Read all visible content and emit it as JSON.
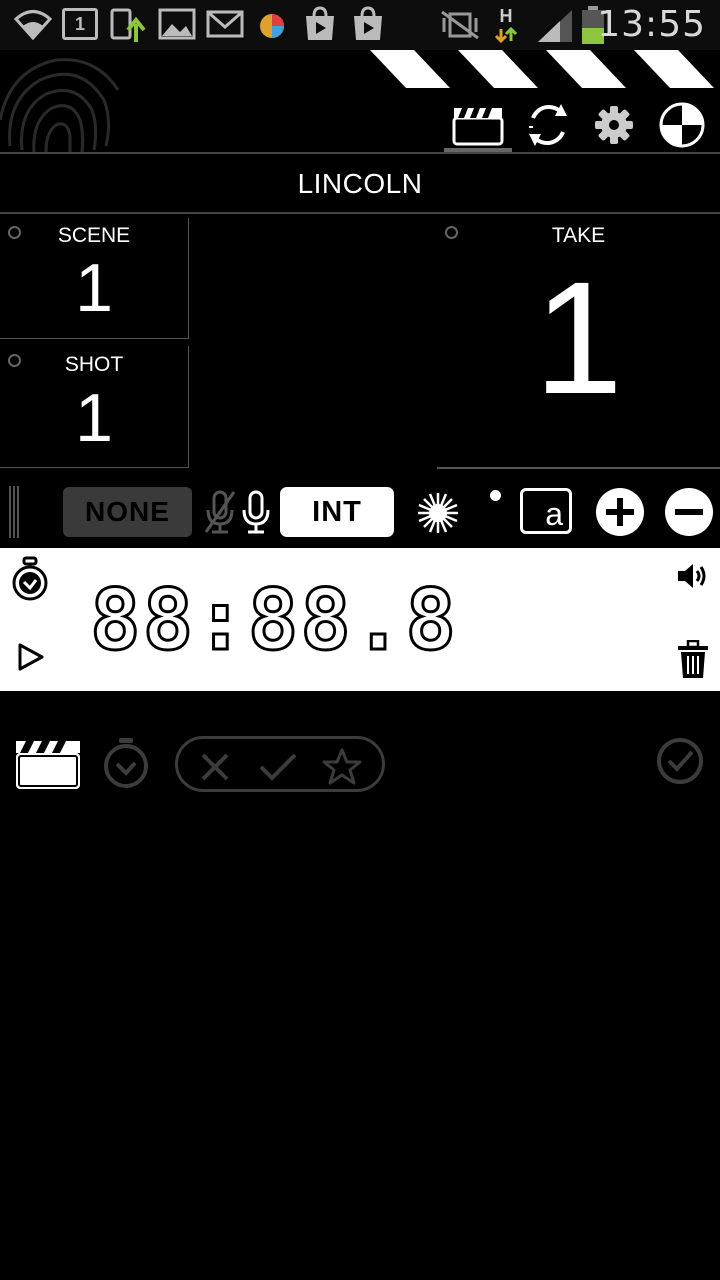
{
  "status_bar": {
    "time": "13:55",
    "network_type": "H",
    "notification_date": "1",
    "icons": [
      "wifi-icon",
      "calendar-icon",
      "upload-icon",
      "gallery-icon",
      "gmail-icon",
      "browser-icon",
      "play-store-icon",
      "play-store-icon",
      "vibrate-icon",
      "network-arrows-icon",
      "signal-icon",
      "battery-icon"
    ]
  },
  "header": {
    "tabs": [
      "clapper-icon",
      "sync-icon",
      "settings-icon",
      "reel-icon"
    ],
    "active_tab": "clapper-icon"
  },
  "project": {
    "title": "LINCOLN"
  },
  "slate": {
    "scene": {
      "label": "SCENE",
      "value": "1"
    },
    "shot": {
      "label": "SHOT",
      "value": "1"
    },
    "take": {
      "label": "TAKE",
      "value": "1"
    }
  },
  "toolbar": {
    "sound_label": "NONE",
    "location_label": "INT",
    "suffix_letter": "a",
    "icons": [
      "drag-handle-icon",
      "mic-off-icon",
      "mic-icon",
      "sun-icon",
      "dot-indicator-icon",
      "plus-icon",
      "minus-icon"
    ]
  },
  "timer": {
    "display": "88:88.8",
    "icons": [
      "stopwatch-icon",
      "play-icon",
      "volume-icon",
      "trash-icon"
    ]
  },
  "bottom": {
    "icons": [
      "clapper-icon",
      "timer-icon",
      "reject-icon",
      "check-icon",
      "star-icon",
      "confirm-icon"
    ]
  },
  "colors": {
    "background": "#000000",
    "panel": "#ffffff",
    "muted_button": "#3a3a3a",
    "battery": "#8cc63f",
    "divider": "#444444"
  }
}
